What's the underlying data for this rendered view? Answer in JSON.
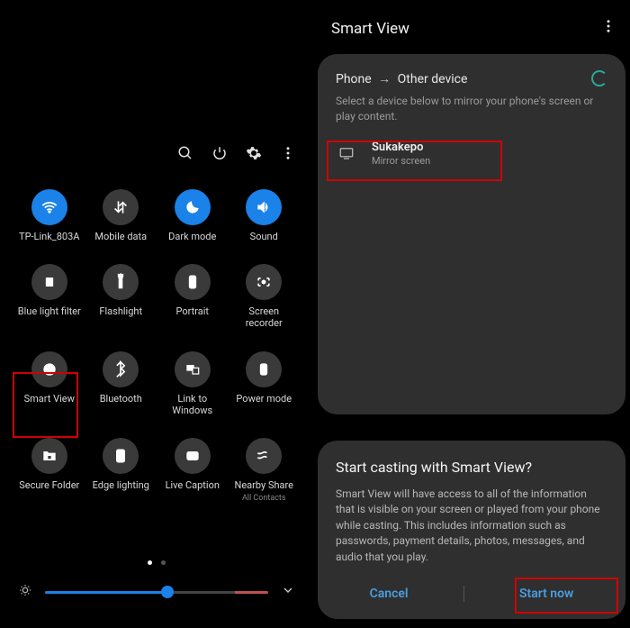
{
  "quick_settings": {
    "tiles": [
      {
        "label": "TP-Link_803A",
        "icon": "wifi-icon",
        "active": true
      },
      {
        "label": "Mobile data",
        "icon": "data-arrows-icon",
        "active": false
      },
      {
        "label": "Dark mode",
        "icon": "moon-icon",
        "active": true
      },
      {
        "label": "Sound",
        "icon": "sound-icon",
        "active": true
      },
      {
        "label": "Blue light filter",
        "icon": "blf-icon",
        "active": false
      },
      {
        "label": "Flashlight",
        "icon": "flashlight-icon",
        "active": false
      },
      {
        "label": "Portrait",
        "icon": "portrait-icon",
        "active": false
      },
      {
        "label": "Screen recorder",
        "icon": "recorder-icon",
        "active": false
      },
      {
        "label": "Smart View",
        "icon": "smartview-icon",
        "active": false,
        "highlight": true
      },
      {
        "label": "Bluetooth",
        "icon": "bluetooth-icon",
        "active": false
      },
      {
        "label": "Link to Windows",
        "icon": "link-windows-icon",
        "active": false
      },
      {
        "label": "Power mode",
        "icon": "power-mode-icon",
        "active": false
      },
      {
        "label": "Secure Folder",
        "icon": "secure-folder-icon",
        "active": false
      },
      {
        "label": "Edge lighting",
        "icon": "edge-lighting-icon",
        "active": false
      },
      {
        "label": "Live Caption",
        "icon": "live-caption-icon",
        "active": false
      },
      {
        "label": "Nearby Share",
        "icon": "nearby-share-icon",
        "active": false,
        "sublabel": "All Contacts"
      }
    ]
  },
  "smart_view": {
    "title": "Smart View",
    "source": "Phone",
    "target": "Other device",
    "subtitle": "Select a device below to mirror your phone's screen or play content.",
    "device": {
      "name": "Sukakepo",
      "action": "Mirror screen"
    }
  },
  "dialog": {
    "title": "Start casting with Smart View?",
    "body": "Smart View will have access to all of the information that is visible on your screen or played from your phone while casting. This includes information such as passwords, payment details, photos, messages, and audio that you play.",
    "cancel": "Cancel",
    "start": "Start now"
  }
}
